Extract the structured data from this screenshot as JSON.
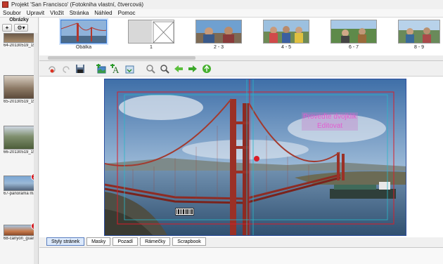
{
  "window": {
    "title": "Projekt 'San Francisco' (Fotokniha vlastní, čtvercová)"
  },
  "menu": [
    "Soubor",
    "Upravit",
    "Vložit",
    "Stránka",
    "Náhled",
    "Pomoc"
  ],
  "sidebar": {
    "header": "Obrázky",
    "add_label": "+",
    "settings_label": "⚙▾",
    "items": [
      {
        "caption": "64-20130519_1518...",
        "badge": ""
      },
      {
        "caption": "65-20130519_1538...",
        "badge": ""
      },
      {
        "caption": "66-20130519_1554...",
        "badge": ""
      },
      {
        "caption": "67-panorama male.J...",
        "badge": "2"
      },
      {
        "caption": "68-canyon_guana.J...",
        "badge": "1"
      }
    ]
  },
  "pages": [
    {
      "label": "Obálka",
      "selected": true
    },
    {
      "label": "1",
      "selected": false
    },
    {
      "label": "2 - 3",
      "selected": false
    },
    {
      "label": "4 - 5",
      "selected": false
    },
    {
      "label": "6 - 7",
      "selected": false
    },
    {
      "label": "8 - 9",
      "selected": false
    }
  ],
  "toolbar": {
    "icons": [
      "delete-icon",
      "redo-icon",
      "save-icon",
      "add-photo-icon",
      "add-text-icon",
      "add-page-icon",
      "zoom-out-icon",
      "zoom-in-icon",
      "prev-arrow-icon",
      "next-arrow-icon",
      "play-icon"
    ]
  },
  "canvas": {
    "overlay_text_1": "Proveďte dvojklik",
    "overlay_text_2": "Editovat"
  },
  "tabs": [
    "Styly stránek",
    "Masky",
    "Pozadí",
    "Rámečky",
    "Scrapbook"
  ],
  "colors": {
    "accent": "#3a7bd5",
    "guide_red": "#d81e2a",
    "guide_cyan": "#29b8c8",
    "badge": "#d4141a"
  }
}
